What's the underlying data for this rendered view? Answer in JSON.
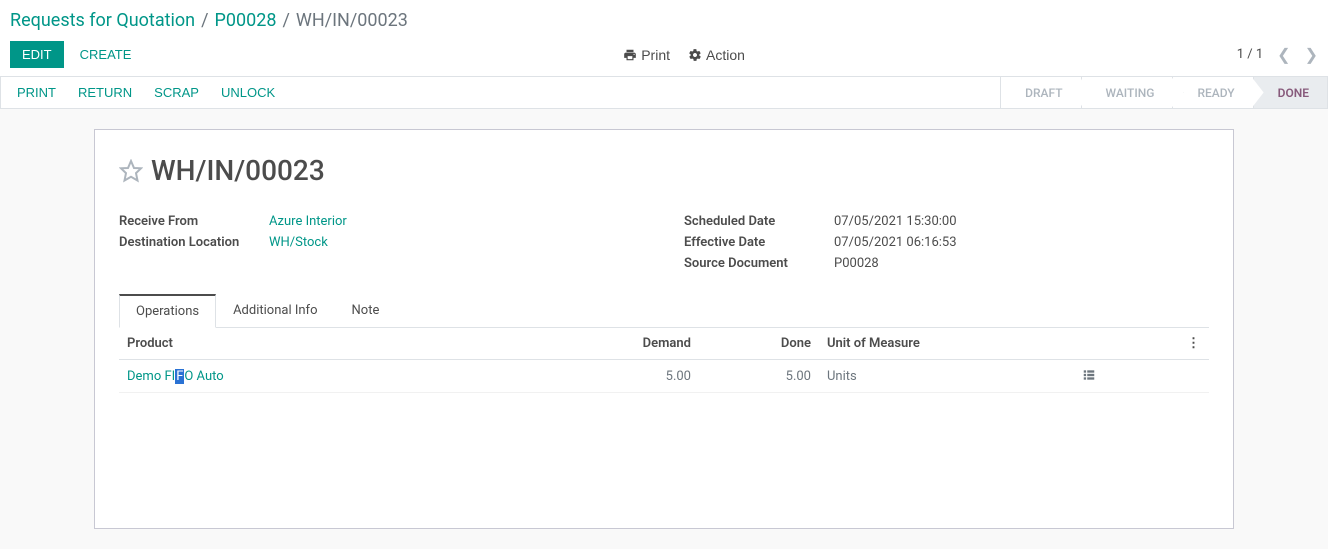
{
  "breadcrumb": {
    "root": "Requests for Quotation",
    "parent": "P00028",
    "current": "WH/IN/00023"
  },
  "controls": {
    "edit_label": "EDIT",
    "create_label": "CREATE",
    "print_label": "Print",
    "action_label": "Action",
    "pager": "1 / 1"
  },
  "actions": {
    "print": "PRINT",
    "return": "RETURN",
    "scrap": "SCRAP",
    "unlock": "UNLOCK"
  },
  "status": [
    "DRAFT",
    "WAITING",
    "READY",
    "DONE"
  ],
  "status_active_index": 3,
  "record": {
    "title": "WH/IN/00023",
    "left": {
      "receive_from_label": "Receive From",
      "receive_from_value": "Azure Interior",
      "destination_label": "Destination Location",
      "destination_value": "WH/Stock"
    },
    "right": {
      "scheduled_label": "Scheduled Date",
      "scheduled_value": "07/05/2021 15:30:00",
      "effective_label": "Effective Date",
      "effective_value": "07/05/2021 06:16:53",
      "source_label": "Source Document",
      "source_value": "P00028"
    }
  },
  "tabs": [
    "Operations",
    "Additional Info",
    "Note"
  ],
  "tabs_active_index": 0,
  "table": {
    "headers": {
      "product": "Product",
      "demand": "Demand",
      "done": "Done",
      "uom": "Unit of Measure"
    },
    "rows": [
      {
        "product_pre": "Demo FI",
        "product_hl": "F",
        "product_post": "O Auto",
        "demand": "5.00",
        "done": "5.00",
        "uom": "Units"
      }
    ]
  }
}
